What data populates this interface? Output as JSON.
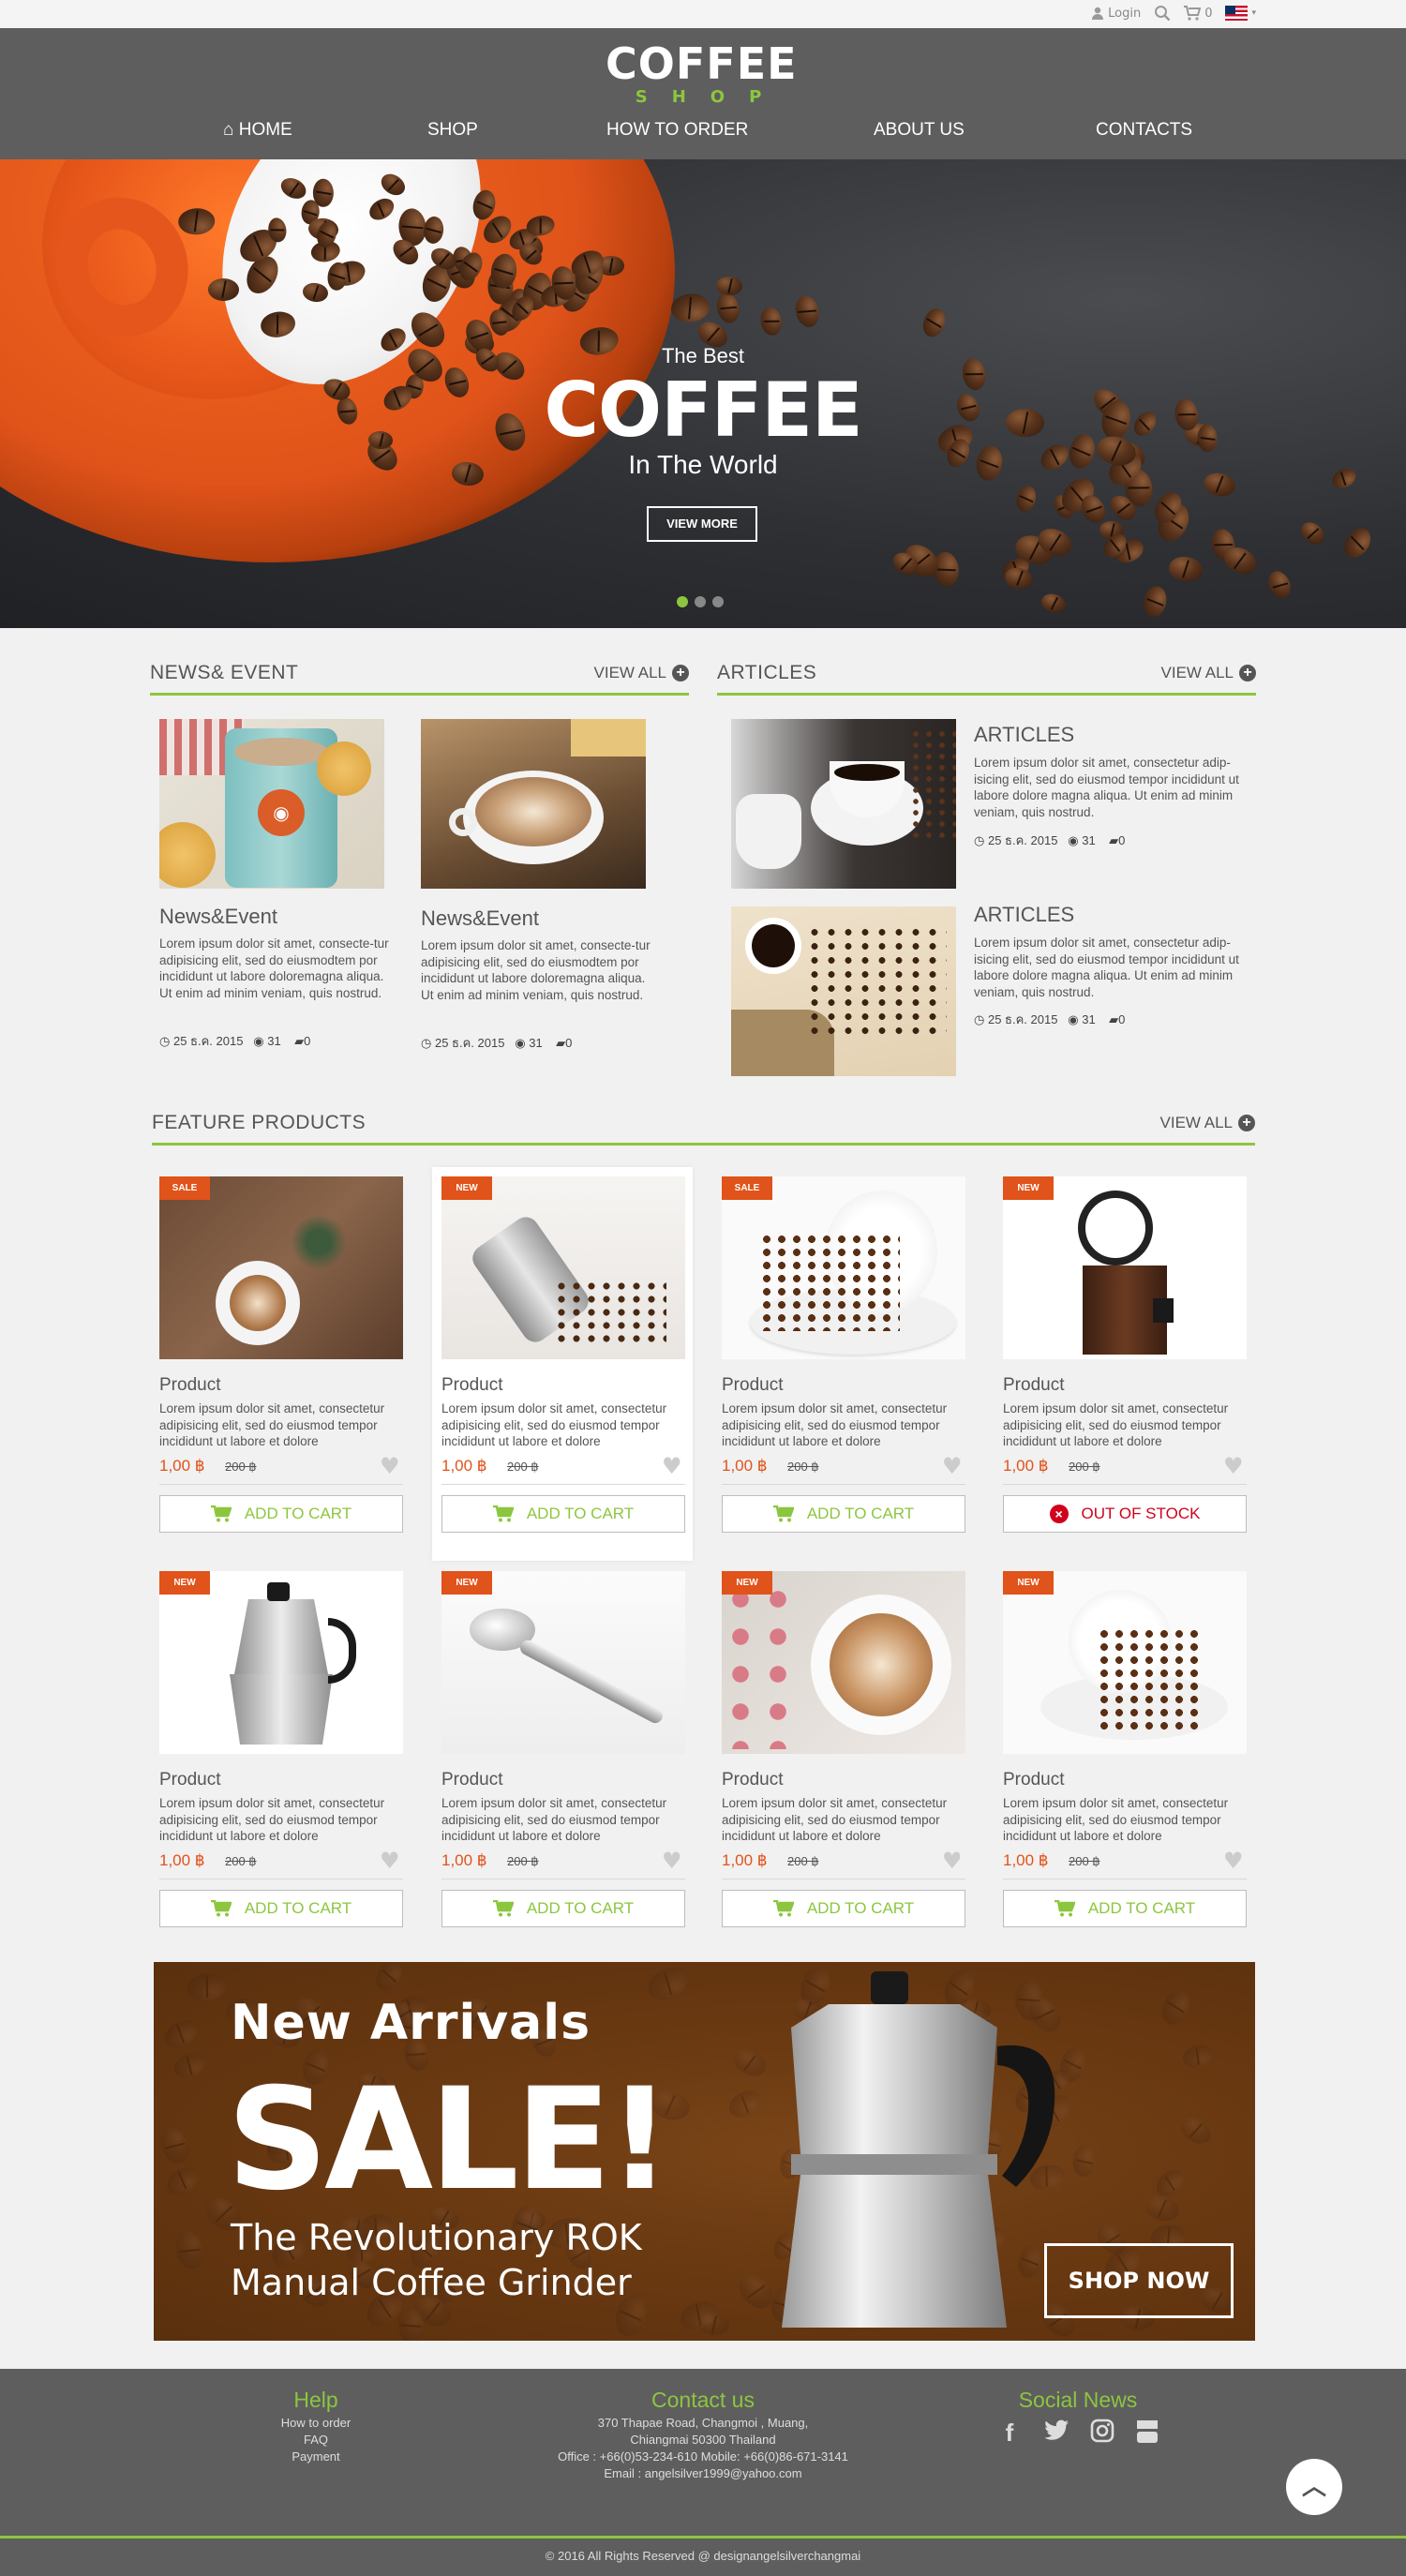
{
  "topbar": {
    "login": "Login",
    "cart_count": "0"
  },
  "logo": {
    "main": "COFFEE",
    "sub": "SHOP"
  },
  "nav": {
    "home": "HOME",
    "shop": "SHOP",
    "how_to_order": "HOW TO ORDER",
    "about": "ABOUT US",
    "contacts": "CONTACTS"
  },
  "hero": {
    "sub1": "The Best",
    "title": "COFFEE",
    "sub2": "In The World",
    "button": "VIEW MORE"
  },
  "news": {
    "heading": "NEWS& EVENT",
    "view_all": "VIEW ALL",
    "items": [
      {
        "title": "News&Event",
        "text": "Lorem ipsum dolor sit amet, consecte-tur adipisicing elit, sed do eiusmodtem por incididunt ut labore doloremagna aliqua. Ut enim ad minim veniam, quis nostrud.",
        "date": "25 ธ.ค. 2015",
        "views": "31",
        "comments": "0"
      },
      {
        "title": "News&Event",
        "text": "Lorem ipsum dolor sit amet, consecte-tur adipisicing elit, sed do eiusmodtem por incididunt ut labore doloremagna aliqua. Ut enim ad minim veniam, quis nostrud.",
        "date": "25 ธ.ค. 2015",
        "views": "31",
        "comments": "0"
      }
    ]
  },
  "articles": {
    "heading": "ARTICLES",
    "view_all": "VIEW ALL",
    "items": [
      {
        "title": "ARTICLES",
        "text": "Lorem ipsum dolor sit amet, consectetur adip-isicing elit, sed do eiusmod tempor incididunt ut labore dolore magna aliqua. Ut enim ad minim veniam, quis nostrud.",
        "date": "25 ธ.ค. 2015",
        "views": "31",
        "comments": "0"
      },
      {
        "title": "ARTICLES",
        "text": "Lorem ipsum dolor sit amet, consectetur adip-isicing elit, sed do eiusmod tempor incididunt ut labore dolore magna aliqua. Ut enim ad minim veniam, quis nostrud.",
        "date": "25 ธ.ค. 2015",
        "views": "31",
        "comments": "0"
      }
    ]
  },
  "products": {
    "heading": "FEATURE PRODUCTS",
    "view_all": "VIEW ALL",
    "items": [
      {
        "badge": "SALE",
        "name": "Product",
        "desc": "Lorem ipsum dolor sit amet, consectetur adipisicing elit, sed do eiusmod tempor incididunt ut labore et dolore",
        "price": "1,00 ฿",
        "old_price": "200 ฿",
        "button": "ADD TO CART"
      },
      {
        "badge": "NEW",
        "name": "Product",
        "desc": "Lorem ipsum dolor sit amet, consectetur adipisicing elit, sed do eiusmod tempor incididunt ut labore et dolore",
        "price": "1,00 ฿",
        "old_price": "200 ฿",
        "button": "ADD TO CART"
      },
      {
        "badge": "SALE",
        "name": "Product",
        "desc": "Lorem ipsum dolor sit amet, consectetur adipisicing elit, sed do eiusmod tempor incididunt ut labore et dolore",
        "price": "1,00 ฿",
        "old_price": "200 ฿",
        "button": "ADD TO CART"
      },
      {
        "badge": "NEW",
        "name": "Product",
        "desc": "Lorem ipsum dolor sit amet, consectetur adipisicing elit, sed do eiusmod tempor incididunt ut labore et dolore",
        "price": "1,00 ฿",
        "old_price": "200 ฿",
        "button": "OUT OF STOCK"
      },
      {
        "badge": "NEW",
        "name": "Product",
        "desc": "Lorem ipsum dolor sit amet, consectetur adipisicing elit, sed do eiusmod tempor incididunt ut labore et dolore",
        "price": "1,00 ฿",
        "old_price": "200 ฿",
        "button": "ADD TO CART"
      },
      {
        "badge": "NEW",
        "name": "Product",
        "desc": "Lorem ipsum dolor sit amet, consectetur adipisicing elit, sed do eiusmod tempor incididunt ut labore et dolore",
        "price": "1,00 ฿",
        "old_price": "200 ฿",
        "button": "ADD TO CART"
      },
      {
        "badge": "NEW",
        "name": "Product",
        "desc": "Lorem ipsum dolor sit amet, consectetur adipisicing elit, sed do eiusmod tempor incididunt ut labore et dolore",
        "price": "1,00 ฿",
        "old_price": "200 ฿",
        "button": "ADD TO CART"
      },
      {
        "badge": "NEW",
        "name": "Product",
        "desc": "Lorem ipsum dolor sit amet, consectetur adipisicing elit, sed do eiusmod tempor incididunt ut labore et dolore",
        "price": "1,00 ฿",
        "old_price": "200 ฿",
        "button": "ADD TO CART"
      }
    ]
  },
  "banner": {
    "line_new": "New Arrivals",
    "line_sale": "SALE!",
    "line_desc1": "The Revolutionary ROK",
    "line_desc2": "Manual Coffee Grinder",
    "button": "SHOP NOW"
  },
  "footer": {
    "help_title": "Help",
    "help_links": [
      "How to order",
      "FAQ",
      "Payment"
    ],
    "contact_title": "Contact us",
    "contact_lines": [
      "370 Thapae Road, Changmoi , Muang,",
      "Chiangmai 50300 Thailand",
      "Office : +66(0)53-234-610  Mobile: +66(0)86-671-3141",
      "Email : angelsilver1999@yahoo.com"
    ],
    "social_title": "Social News",
    "copyright": "© 2016 All Rights Reserved @ designangelsilverchangmai"
  },
  "colors": {
    "accent_green": "#8cc63f",
    "accent_orange": "#e0531a",
    "header_gray": "#5e5e5e",
    "danger_red": "#d0021b"
  }
}
